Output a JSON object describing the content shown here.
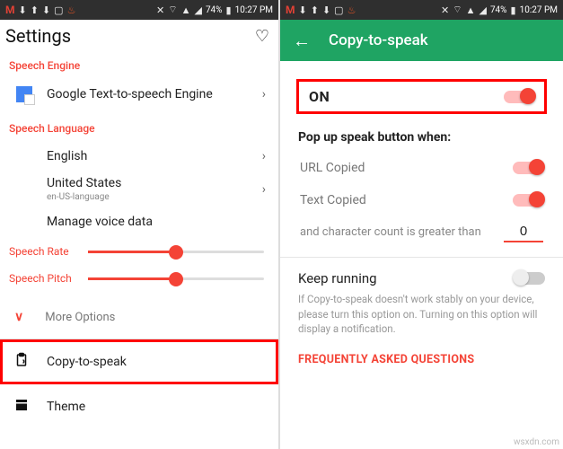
{
  "status_bar": {
    "battery_text": "74%",
    "time": "10:27 PM"
  },
  "left": {
    "title": "Settings",
    "sections": {
      "engine_label": "Speech Engine",
      "engine_item": "Google Text-to-speech Engine",
      "language_label": "Speech Language",
      "language_item": "English",
      "country_item": "United States",
      "country_sub": "en-US-language",
      "manage_voice": "Manage voice data",
      "rate_label": "Speech Rate",
      "pitch_label": "Speech Pitch",
      "more_options": "More Options",
      "menu_copy": "Copy-to-speak",
      "menu_theme": "Theme"
    }
  },
  "right": {
    "appbar_title": "Copy-to-speak",
    "on_label": "ON",
    "popup_title": "Pop up speak button when:",
    "url_copied": "URL Copied",
    "text_copied": "Text Copied",
    "char_count_label": "and character count is greater than",
    "char_count_value": "0",
    "keep_running": "Keep running",
    "keep_desc": "If Copy-to-speak doesn't work stably on your device, please turn this option on.\nTurning on this option will display a notification.",
    "faq": "FREQUENTLY ASKED QUESTIONS"
  },
  "watermark": "wsxdn.com"
}
